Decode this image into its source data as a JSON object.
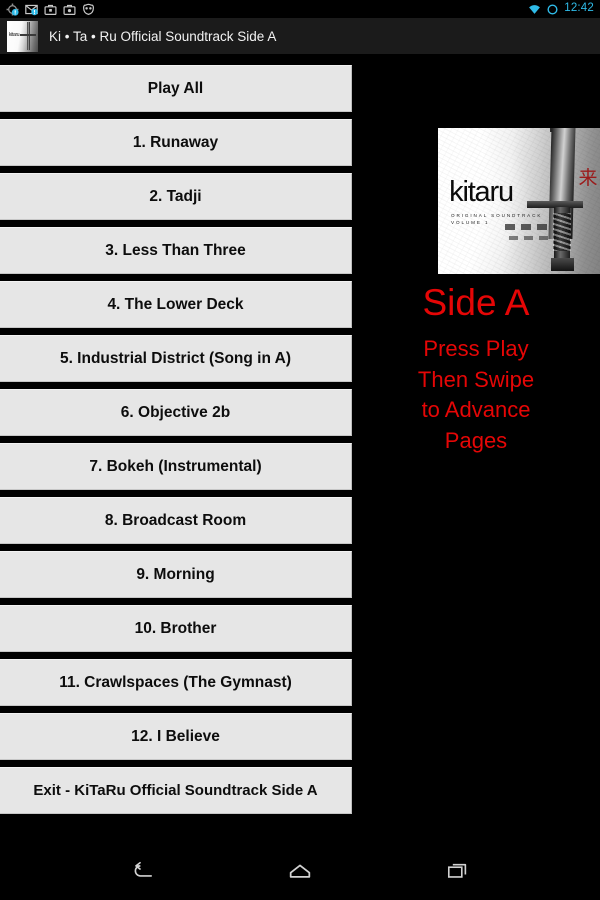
{
  "status_bar": {
    "icons": [
      {
        "name": "sync-error-icon"
      },
      {
        "name": "email-icon"
      },
      {
        "name": "briefcase-icon"
      },
      {
        "name": "briefcase-alt-icon"
      },
      {
        "name": "owl-app-icon"
      }
    ],
    "wifi_icon": "wifi-icon",
    "battery_icon": "battery-circle-icon",
    "clock": "12:42",
    "accent_color": "#2fbbe8"
  },
  "action_bar": {
    "app_icon": "album-art-thumbnail-icon",
    "title": "Ki • Ta • Ru Official Soundtrack Side A",
    "background_color": "#1b1b1b"
  },
  "track_list": {
    "play_all_label": "Play All",
    "tracks": [
      "1. Runaway",
      "2. Tadji",
      "3. Less Than Three",
      "4. The Lower Deck",
      "5. Industrial District (Song in A)",
      "6. Objective 2b",
      "7. Bokeh (Instrumental)",
      "8. Broadcast Room",
      "9. Morning",
      "10. Brother",
      "11. Crawlspaces (The Gymnast)",
      "12. I Believe"
    ],
    "exit_label": "Exit - KiTaRu Official Soundtrack Side A",
    "button_color": "#e6e6e6",
    "text_color": "#0d0d0d"
  },
  "right_panel": {
    "album_art": {
      "logo": "kitaru",
      "subtitle_line1": "ORIGINAL SOUNDTRACK",
      "subtitle_line2": "VOLUME 1",
      "kanji": "来る",
      "alt": "kitaru album cover with katana sword"
    },
    "side_label": "Side A",
    "instructions": [
      "Press Play",
      "Then Swipe",
      "to Advance",
      "Pages"
    ],
    "red_color": "#e50606"
  },
  "nav_bar": {
    "back_label": "back-icon",
    "home_label": "home-icon",
    "recents_label": "recents-icon"
  }
}
